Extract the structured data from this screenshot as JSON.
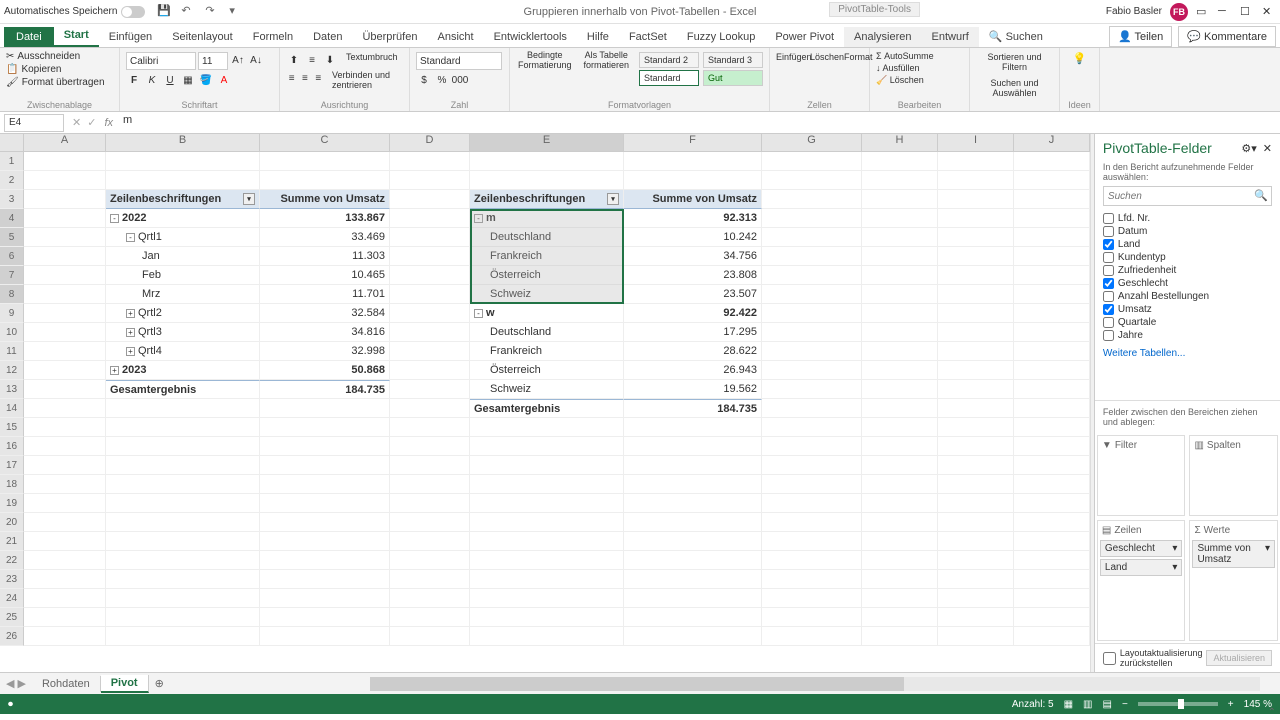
{
  "titlebar": {
    "autosave": "Automatisches Speichern",
    "doc_title": "Gruppieren innerhalb von Pivot-Tabellen - Excel",
    "pivot_tools": "PivotTable-Tools",
    "user_name": "Fabio Basler",
    "user_initials": "FB"
  },
  "tabs": {
    "file": "Datei",
    "items": [
      "Start",
      "Einfügen",
      "Seitenlayout",
      "Formeln",
      "Daten",
      "Überprüfen",
      "Ansicht",
      "Entwicklertools",
      "Hilfe",
      "FactSet",
      "Fuzzy Lookup",
      "Power Pivot"
    ],
    "context": [
      "Analysieren",
      "Entwurf"
    ],
    "search": "Suchen",
    "share": "Teilen",
    "comments": "Kommentare"
  },
  "ribbon": {
    "clipboard": {
      "cut": "Ausschneiden",
      "copy": "Kopieren",
      "format": "Format übertragen",
      "label": "Zwischenablage"
    },
    "font": {
      "name": "Calibri",
      "size": "11",
      "label": "Schriftart"
    },
    "align": {
      "wrap": "Textumbruch",
      "merge": "Verbinden und zentrieren",
      "label": "Ausrichtung"
    },
    "number": {
      "format": "Standard",
      "label": "Zahl"
    },
    "styles": {
      "cond": "Bedingte Formatierung",
      "table": "Als Tabelle formatieren",
      "s2": "Standard 2",
      "s3": "Standard 3",
      "std": "Standard",
      "gut": "Gut",
      "label": "Formatvorlagen"
    },
    "cells": {
      "insert": "Einfügen",
      "delete": "Löschen",
      "format": "Format",
      "label": "Zellen"
    },
    "editing": {
      "sum": "AutoSumme",
      "fill": "Ausfüllen",
      "clear": "Löschen",
      "sort": "Sortieren und Filtern",
      "find": "Suchen und Auswählen",
      "label": "Bearbeiten"
    },
    "ideas": {
      "label": "Ideen"
    }
  },
  "formula": {
    "cell_ref": "E4",
    "value": "m"
  },
  "columns": [
    "A",
    "B",
    "C",
    "D",
    "E",
    "F",
    "G",
    "H",
    "I",
    "J"
  ],
  "pivot1": {
    "hdr_labels": "Zeilenbeschriftungen",
    "hdr_values": "Summe von Umsatz",
    "rows": [
      {
        "lbl": "2022",
        "val": "133.867",
        "lvl": 0,
        "exp": "-"
      },
      {
        "lbl": "Qrtl1",
        "val": "33.469",
        "lvl": 1,
        "exp": "-"
      },
      {
        "lbl": "Jan",
        "val": "11.303",
        "lvl": 2
      },
      {
        "lbl": "Feb",
        "val": "10.465",
        "lvl": 2
      },
      {
        "lbl": "Mrz",
        "val": "11.701",
        "lvl": 2
      },
      {
        "lbl": "Qrtl2",
        "val": "32.584",
        "lvl": 1,
        "exp": "+"
      },
      {
        "lbl": "Qrtl3",
        "val": "34.816",
        "lvl": 1,
        "exp": "+"
      },
      {
        "lbl": "Qrtl4",
        "val": "32.998",
        "lvl": 1,
        "exp": "+"
      },
      {
        "lbl": "2023",
        "val": "50.868",
        "lvl": 0,
        "exp": "+"
      }
    ],
    "total_lbl": "Gesamtergebnis",
    "total_val": "184.735"
  },
  "pivot2": {
    "hdr_labels": "Zeilenbeschriftungen",
    "hdr_values": "Summe von Umsatz",
    "rows": [
      {
        "lbl": "m",
        "val": "92.313",
        "lvl": 0,
        "exp": "-"
      },
      {
        "lbl": "Deutschland",
        "val": "10.242",
        "lvl": 1
      },
      {
        "lbl": "Frankreich",
        "val": "34.756",
        "lvl": 1
      },
      {
        "lbl": "Österreich",
        "val": "23.808",
        "lvl": 1
      },
      {
        "lbl": "Schweiz",
        "val": "23.507",
        "lvl": 1
      },
      {
        "lbl": "w",
        "val": "92.422",
        "lvl": 0,
        "exp": "-"
      },
      {
        "lbl": "Deutschland",
        "val": "17.295",
        "lvl": 1
      },
      {
        "lbl": "Frankreich",
        "val": "28.622",
        "lvl": 1
      },
      {
        "lbl": "Österreich",
        "val": "26.943",
        "lvl": 1
      },
      {
        "lbl": "Schweiz",
        "val": "19.562",
        "lvl": 1
      }
    ],
    "total_lbl": "Gesamtergebnis",
    "total_val": "184.735"
  },
  "sheets": {
    "tabs": [
      "Rohdaten",
      "Pivot"
    ],
    "active": 1
  },
  "statusbar": {
    "count_lbl": "Anzahl: 5",
    "zoom": "145 %"
  },
  "pane": {
    "title": "PivotTable-Felder",
    "subtitle": "In den Bericht aufzunehmende Felder auswählen:",
    "search_ph": "Suchen",
    "fields": [
      {
        "name": "Lfd. Nr.",
        "checked": false
      },
      {
        "name": "Datum",
        "checked": false
      },
      {
        "name": "Land",
        "checked": true
      },
      {
        "name": "Kundentyp",
        "checked": false
      },
      {
        "name": "Zufriedenheit",
        "checked": false
      },
      {
        "name": "Geschlecht",
        "checked": true
      },
      {
        "name": "Anzahl Bestellungen",
        "checked": false
      },
      {
        "name": "Umsatz",
        "checked": true
      },
      {
        "name": "Quartale",
        "checked": false
      },
      {
        "name": "Jahre",
        "checked": false
      }
    ],
    "more_tables": "Weitere Tabellen...",
    "drop_hint": "Felder zwischen den Bereichen ziehen und ablegen:",
    "areas": {
      "filter": "Filter",
      "columns": "Spalten",
      "rows": "Zeilen",
      "values": "Werte"
    },
    "row_items": [
      "Geschlecht",
      "Land"
    ],
    "value_items": [
      "Summe von Umsatz"
    ],
    "defer": "Layoutaktualisierung zurückstellen",
    "update": "Aktualisieren"
  }
}
